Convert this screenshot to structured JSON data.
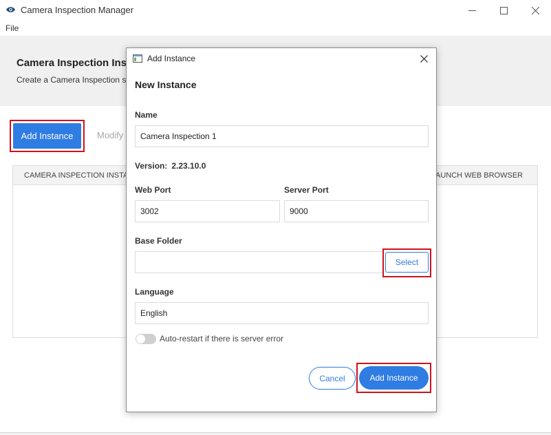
{
  "window": {
    "title": "Camera Inspection Manager",
    "menu": {
      "file": "File"
    }
  },
  "page": {
    "title": "Camera Inspection Insta",
    "subtitle": "Create a Camera Inspection se"
  },
  "toolbar": {
    "add_instance_label": "Add Instance",
    "modify_label": "Modify"
  },
  "table": {
    "columns": [
      "CAMERA INSPECTION INSTANC",
      "AUNCH WEB BROWSER"
    ]
  },
  "dialog": {
    "title": "Add Instance",
    "heading": "New Instance",
    "name_label": "Name",
    "name_value": "Camera Inspection 1",
    "version_label": "Version:",
    "version_value": "2.23.10.0",
    "web_port_label": "Web Port",
    "web_port_value": "3002",
    "server_port_label": "Server Port",
    "server_port_value": "9000",
    "base_folder_label": "Base Folder",
    "base_folder_value": "",
    "select_label": "Select",
    "language_label": "Language",
    "language_value": "English",
    "auto_restart_label": "Auto-restart if there is server error",
    "auto_restart_enabled": false,
    "cancel_label": "Cancel",
    "add_label": "Add Instance"
  },
  "colors": {
    "accent": "#2f7ce3",
    "highlight": "#d0101a"
  }
}
